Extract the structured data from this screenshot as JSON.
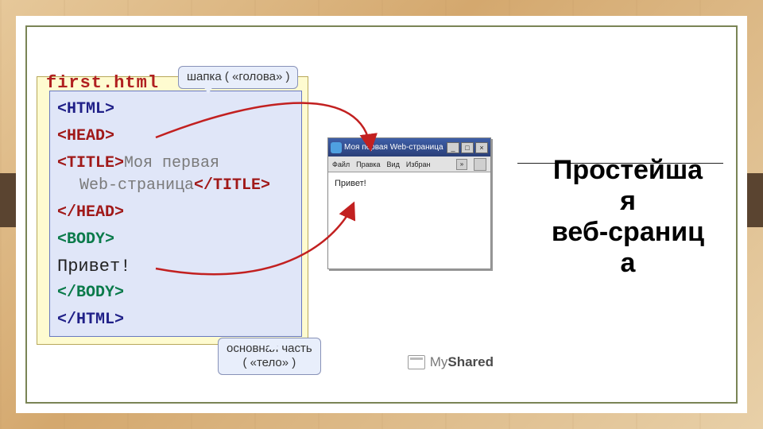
{
  "slide": {
    "headline_l1": "Простейша",
    "headline_l2": "я",
    "headline_l3": "веб-сраниц",
    "headline_l4": "а"
  },
  "notepad": {
    "filename": "first.html",
    "tag_html_open": "<HTML>",
    "tag_head_open": "<HEAD>",
    "tag_title_open": "<TITLE>",
    "title_text1": "Моя первая",
    "title_text2": "Web-страница",
    "tag_title_close": "</TITLE>",
    "tag_head_close": "</HEAD>",
    "tag_body_open": "<BODY>",
    "body_text": "Привет!",
    "tag_body_close": "</BODY>",
    "tag_html_close": "</HTML>"
  },
  "callouts": {
    "top": "шапка ( «голова» )",
    "bottom_l1": "основная часть",
    "bottom_l2": "( «тело» )"
  },
  "browser": {
    "title": "Моя первая Web-страница ...",
    "menu": {
      "file": "Файл",
      "edit": "Правка",
      "view": "Вид",
      "fav": "Избран"
    },
    "content": "Привет!"
  },
  "watermark": {
    "prefix": "My",
    "suffix": "Shared"
  }
}
